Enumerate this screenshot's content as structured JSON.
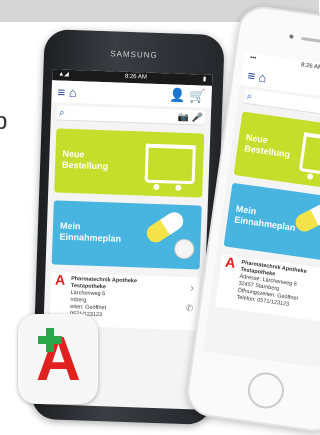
{
  "headline_fragment": "p",
  "samsung": {
    "brand": "SAMSUNG",
    "status": {
      "left": "▲◢",
      "time": "8:26 AM",
      "right": "▮"
    },
    "tiles": [
      {
        "line1": "Neue",
        "line2": "Bestellung"
      },
      {
        "line1": "Mein",
        "line2": "Einnahmeplan"
      }
    ],
    "pharmacy": {
      "name": "Pharmatechnik Apotheke",
      "sub": "Testapotheke",
      "addr": "Lärchenweg 6",
      "city": "rnberg",
      "hours": "eiten: Geöffnet",
      "tel": "0571/123123"
    }
  },
  "iphone": {
    "status": {
      "time": "8:26 AM"
    },
    "tiles": [
      {
        "line1": "Neue",
        "line2": "Bestellung"
      },
      {
        "line1": "Mein",
        "line2": "Einnahmeplan"
      }
    ],
    "pharmacy": {
      "name": "Pharmatechnik Apotheke",
      "sub": "Testapotheke",
      "addr": "Adresse: Lärchenweg 6",
      "city": "32457 Starnberg",
      "hours": "Öffnungszeiten: Geöffnet",
      "tel": "Telefon: 0571/123123"
    }
  },
  "icons": {
    "menu": "menu-icon",
    "home": "home-icon",
    "user": "user-icon",
    "cart": "cart-icon",
    "search": "search-icon",
    "camera": "camera-icon",
    "mic": "mic-icon"
  }
}
